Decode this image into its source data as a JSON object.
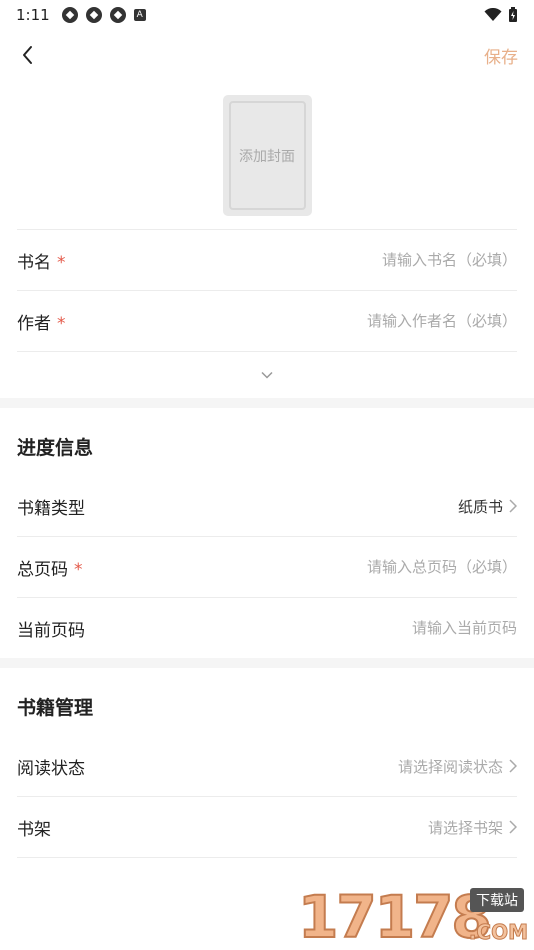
{
  "status_bar": {
    "time": "1:11",
    "a_badge": "A"
  },
  "top_bar": {
    "save_label": "保存"
  },
  "cover": {
    "label": "添加封面"
  },
  "basic": {
    "title_label": "书名",
    "title_placeholder": "请输入书名（必填）",
    "author_label": "作者",
    "author_placeholder": "请输入作者名（必填）",
    "required_mark": "*"
  },
  "progress": {
    "section_title": "进度信息",
    "type_label": "书籍类型",
    "type_value": "纸质书",
    "total_label": "总页码",
    "total_placeholder": "请输入总页码（必填）",
    "current_label": "当前页码",
    "current_placeholder": "请输入当前页码"
  },
  "management": {
    "section_title": "书籍管理",
    "status_label": "阅读状态",
    "status_placeholder": "请选择阅读状态",
    "shelf_label": "书架",
    "shelf_placeholder": "请选择书架"
  },
  "watermark": {
    "digits": "17178",
    "tag": "下载站",
    "com": ".COM"
  },
  "colors": {
    "accent": "#e8b08a",
    "required": "#e45a4a",
    "placeholder": "#aaaaaa"
  }
}
